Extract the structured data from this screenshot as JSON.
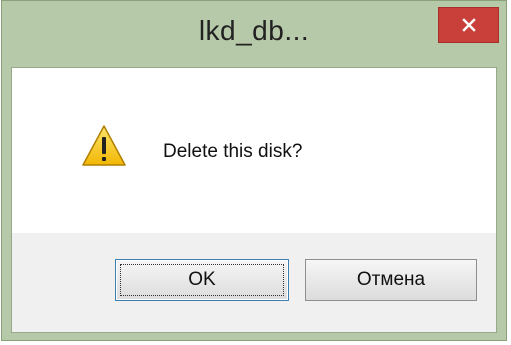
{
  "window": {
    "title": "lkd_db...",
    "close_icon": "close-icon"
  },
  "dialog": {
    "icon": "warning-icon",
    "message": "Delete this disk?"
  },
  "buttons": {
    "ok_label": "OK",
    "cancel_label": "Отмена"
  },
  "colors": {
    "frame": "#b6c9a8",
    "close_button": "#c9403a",
    "warning_yellow": "#f5c518"
  }
}
